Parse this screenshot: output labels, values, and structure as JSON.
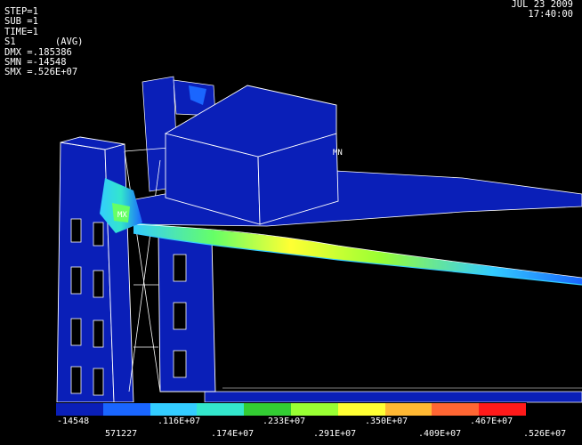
{
  "info": {
    "step": "STEP=1",
    "sub": "SUB =1",
    "time": "TIME=1",
    "result": "S1       (AVG)",
    "dmx": "DMX =.185386",
    "smn": "SMN =-14548",
    "smx": "SMX =.526E+07"
  },
  "stamp": {
    "date": "JUL 23 2009",
    "time": "17:40:00"
  },
  "markers": {
    "mx": "MX",
    "mn": "MN"
  },
  "legend": {
    "colors": [
      "#0a1fb8",
      "#1a66ff",
      "#33ccff",
      "#33e6cc",
      "#33cc33",
      "#99ff33",
      "#ffff33",
      "#ffb833",
      "#ff6633",
      "#ff1a1a"
    ],
    "labels_top": [
      "-14548",
      ".116E+07",
      ".233E+07",
      ".350E+07",
      ".467E+07"
    ],
    "labels_bottom": [
      "571227",
      ".174E+07",
      ".291E+07",
      ".409E+07",
      ".526E+07"
    ]
  }
}
